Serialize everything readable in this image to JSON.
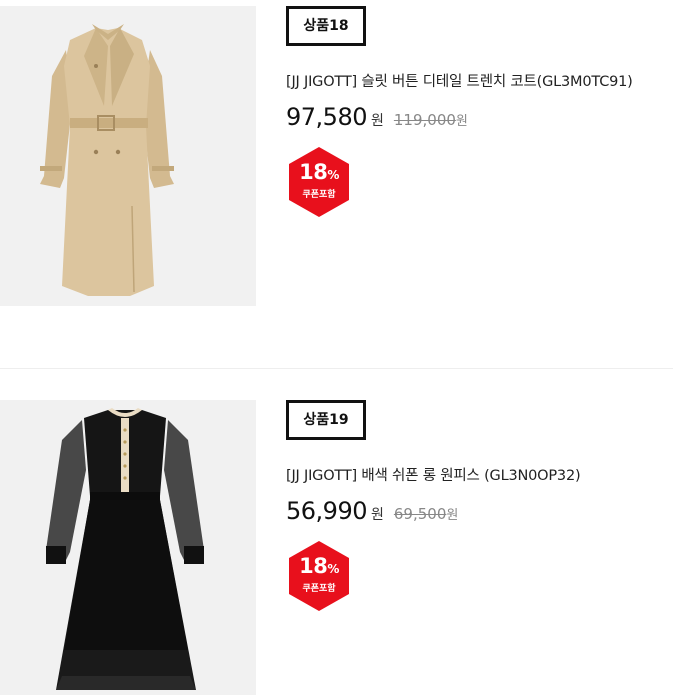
{
  "products": [
    {
      "badge": "상품18",
      "name": "[JJ JIGOTT] 슬릿 버튼 디테일 트렌치 코트(GL3M0TC91)",
      "price": "97,580",
      "price_unit": "원",
      "original_price": "119,000",
      "original_unit": "원",
      "coupon_percent": "18",
      "coupon_symbol": "%",
      "coupon_label": "쿠폰포함",
      "image_icon": "trench-coat-icon"
    },
    {
      "badge": "상품19",
      "name": "[JJ JIGOTT] 배색 쉬폰 롱 원피스 (GL3N0OP32)",
      "price": "56,990",
      "price_unit": "원",
      "original_price": "69,500",
      "original_unit": "원",
      "coupon_percent": "18",
      "coupon_symbol": "%",
      "coupon_label": "쿠폰포함",
      "image_icon": "black-dress-icon"
    }
  ],
  "colors": {
    "coupon_red": "#e8101c",
    "image_bg": "#f1f1f1",
    "coat_beige": "#d9c29a",
    "dress_black": "#151515"
  }
}
